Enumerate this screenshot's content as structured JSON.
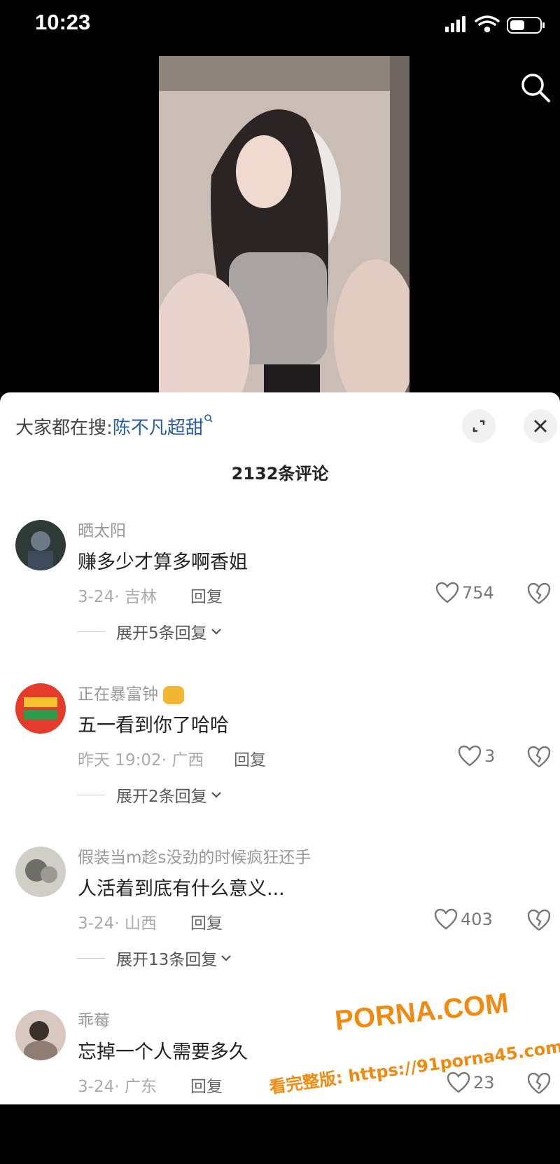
{
  "status_bar": {
    "time": "10:23"
  },
  "search_prompt": {
    "label": "大家都在搜:",
    "keyword": "陈不凡超甜"
  },
  "comment_count": "2132条评论",
  "comments": [
    {
      "user": "晒太阳",
      "text": "赚多少才算多啊香姐",
      "meta": "3-24· 吉林",
      "reply": "回复",
      "likes": "754",
      "expand": "展开5条回复"
    },
    {
      "user": "正在暴富钟",
      "text": "五一看到你了哈哈",
      "meta": "昨天 19:02· 广西",
      "reply": "回复",
      "likes": "3",
      "expand": "展开2条回复"
    },
    {
      "user": "假装当m趁s没劲的时候疯狂还手",
      "text": "人活着到底有什么意义...",
      "meta": "3-24· 山西",
      "reply": "回复",
      "likes": "403",
      "expand": "展开13条回复"
    },
    {
      "user": "乖莓",
      "text": "忘掉一个人需要多久",
      "meta": "3-24· 广东",
      "reply": "回复",
      "likes": "23"
    }
  ],
  "watermark": {
    "brand": "PORNA.COM",
    "line": "看完整版: https://91porna45.com"
  },
  "colors": {
    "keyword": "#2a5d9f",
    "watermark": "#f08a10"
  }
}
